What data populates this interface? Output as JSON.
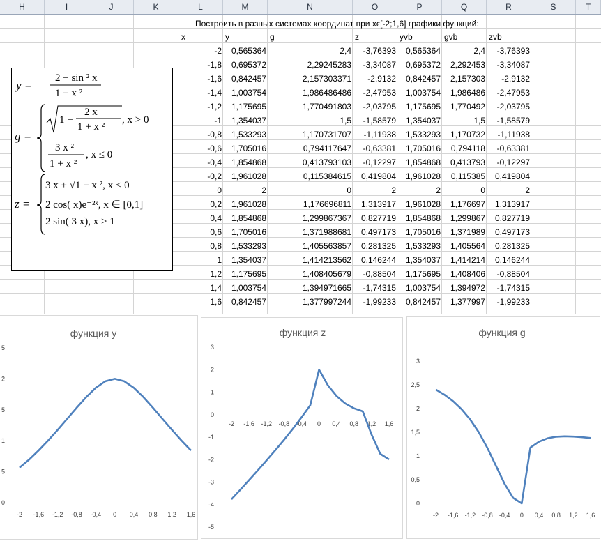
{
  "columns": [
    "H",
    "I",
    "J",
    "K",
    "L",
    "M",
    "N",
    "O",
    "P",
    "Q",
    "R",
    "S",
    "T"
  ],
  "sheet": {
    "title": "Построить в разных системах координат при xϵ[-2;1,6] графики функций:",
    "headers": [
      "x",
      "y",
      "g",
      "z",
      "yvb",
      "gvb",
      "zvb"
    ],
    "rows": [
      [
        "-2",
        "0,565364",
        "2,4",
        "-3,76393",
        "0,565364",
        "2,4",
        "-3,76393"
      ],
      [
        "-1,8",
        "0,695372",
        "2,29245283",
        "-3,34087",
        "0,695372",
        "2,292453",
        "-3,34087"
      ],
      [
        "-1,6",
        "0,842457",
        "2,157303371",
        "-2,9132",
        "0,842457",
        "2,157303",
        "-2,9132"
      ],
      [
        "-1,4",
        "1,003754",
        "1,986486486",
        "-2,47953",
        "1,003754",
        "1,986486",
        "-2,47953"
      ],
      [
        "-1,2",
        "1,175695",
        "1,770491803",
        "-2,03795",
        "1,175695",
        "1,770492",
        "-2,03795"
      ],
      [
        "-1",
        "1,354037",
        "1,5",
        "-1,58579",
        "1,354037",
        "1,5",
        "-1,58579"
      ],
      [
        "-0,8",
        "1,533293",
        "1,170731707",
        "-1,11938",
        "1,533293",
        "1,170732",
        "-1,11938"
      ],
      [
        "-0,6",
        "1,705016",
        "0,794117647",
        "-0,63381",
        "1,705016",
        "0,794118",
        "-0,63381"
      ],
      [
        "-0,4",
        "1,854868",
        "0,413793103",
        "-0,12297",
        "1,854868",
        "0,413793",
        "-0,12297"
      ],
      [
        "-0,2",
        "1,961028",
        "0,115384615",
        "0,419804",
        "1,961028",
        "0,115385",
        "0,419804"
      ],
      [
        "0",
        "2",
        "0",
        "2",
        "2",
        "0",
        "2"
      ],
      [
        "0,2",
        "1,961028",
        "1,176696811",
        "1,313917",
        "1,961028",
        "1,176697",
        "1,313917"
      ],
      [
        "0,4",
        "1,854868",
        "1,299867367",
        "0,827719",
        "1,854868",
        "1,299867",
        "0,827719"
      ],
      [
        "0,6",
        "1,705016",
        "1,371988681",
        "0,497173",
        "1,705016",
        "1,371989",
        "0,497173"
      ],
      [
        "0,8",
        "1,533293",
        "1,405563857",
        "0,281325",
        "1,533293",
        "1,405564",
        "0,281325"
      ],
      [
        "1",
        "1,354037",
        "1,414213562",
        "0,146244",
        "1,354037",
        "1,414214",
        "0,146244"
      ],
      [
        "1,2",
        "1,175695",
        "1,408405679",
        "-0,88504",
        "1,175695",
        "1,408406",
        "-0,88504"
      ],
      [
        "1,4",
        "1,003754",
        "1,394971665",
        "-1,74315",
        "1,003754",
        "1,394972",
        "-1,74315"
      ],
      [
        "1,6",
        "0,842457",
        "1,377997244",
        "-1,99233",
        "0,842457",
        "1,377997",
        "-1,99233"
      ]
    ]
  },
  "formulas": {
    "y_lhs": "y =",
    "y_num": "2 + sin ² x",
    "y_den": "1 + x ²",
    "g_lhs": "g =",
    "g_case1_num": "2 x",
    "g_case1_den": "1 + x ²",
    "g_case1_cond": ", x > 0",
    "g_case2_num": "3 x ²",
    "g_case2_den": "1 + x ²",
    "g_case2_cond": ", x ≤ 0",
    "z_lhs": "z =",
    "z_case1": "3 x + √1 + x ², x < 0",
    "z_case2": "2 cos( x)e⁻²ˣ, x ∈ [0,1]",
    "z_case3": "2 sin( 3 x), x > 1"
  },
  "chart_data": [
    {
      "type": "line",
      "title": "функция y",
      "x": [
        -2,
        -1.8,
        -1.6,
        -1.4,
        -1.2,
        -1,
        -0.8,
        -0.6,
        -0.4,
        -0.2,
        0,
        0.2,
        0.4,
        0.6,
        0.8,
        1,
        1.2,
        1.4,
        1.6
      ],
      "x_tick_labels": [
        "-2",
        "-1,6",
        "-1,2",
        "-0,8",
        "-0,4",
        "0",
        "0,4",
        "0,8",
        "1,2",
        "1,6"
      ],
      "y_tick_labels": [
        "0",
        "5",
        "1",
        "5",
        "2",
        "5"
      ],
      "values": [
        0.565364,
        0.695372,
        0.842457,
        1.003754,
        1.175695,
        1.354037,
        1.533293,
        1.705016,
        1.854868,
        1.961028,
        2,
        1.961028,
        1.854868,
        1.705016,
        1.533293,
        1.354037,
        1.175695,
        1.003754,
        0.842457
      ],
      "ylim": [
        0,
        2.5
      ],
      "color": "#4f81bd"
    },
    {
      "type": "line",
      "title": "функция z",
      "x": [
        -2,
        -1.8,
        -1.6,
        -1.4,
        -1.2,
        -1,
        -0.8,
        -0.6,
        -0.4,
        -0.2,
        0,
        0.2,
        0.4,
        0.6,
        0.8,
        1,
        1.2,
        1.4,
        1.6
      ],
      "x_tick_labels": [
        "-2",
        "-1,6",
        "-1,2",
        "-0,8",
        "-0,4",
        "0",
        "0,4",
        "0,8",
        "1,2",
        "1,6"
      ],
      "y_tick_labels": [
        "3",
        "2",
        "1",
        "0",
        "-1",
        "-2",
        "-3",
        "-4",
        "-5"
      ],
      "values": [
        -3.76393,
        -3.34087,
        -2.9132,
        -2.47953,
        -2.03795,
        -1.58579,
        -1.11938,
        -0.63381,
        -0.12297,
        0.419804,
        2,
        1.313917,
        0.827719,
        0.497173,
        0.281325,
        0.146244,
        -0.88504,
        -1.74315,
        -1.99233
      ],
      "ylim": [
        -5,
        3
      ],
      "color": "#4f81bd"
    },
    {
      "type": "line",
      "title": "функция g",
      "x": [
        -2,
        -1.8,
        -1.6,
        -1.4,
        -1.2,
        -1,
        -0.8,
        -0.6,
        -0.4,
        -0.2,
        0,
        0.2,
        0.4,
        0.6,
        0.8,
        1,
        1.2,
        1.4,
        1.6
      ],
      "x_tick_labels": [
        "-2",
        "-1,6",
        "-1,2",
        "-0,8",
        "-0,4",
        "0",
        "0,4",
        "0,8",
        "1,2",
        "1,6"
      ],
      "y_tick_labels": [
        "0",
        "0,5",
        "1",
        "1,5",
        "2",
        "2,5",
        "3"
      ],
      "values": [
        2.4,
        2.29245283,
        2.157303371,
        1.986486486,
        1.770491803,
        1.5,
        1.170731707,
        0.794117647,
        0.413793103,
        0.115384615,
        0,
        1.176696811,
        1.299867367,
        1.371988681,
        1.405563857,
        1.414213562,
        1.408405679,
        1.394971665,
        1.377997244
      ],
      "ylim": [
        0,
        3
      ],
      "color": "#4f81bd"
    }
  ]
}
